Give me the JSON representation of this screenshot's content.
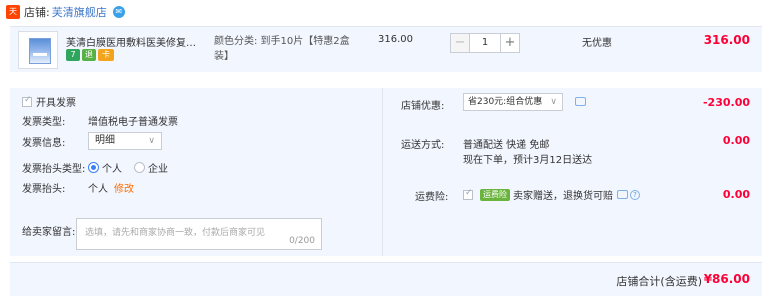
{
  "store": {
    "logo_text": "天猫",
    "prefix": "店铺:",
    "name": "芙清旗舰店"
  },
  "product": {
    "title": "芙清白膜医用敷料医美修复痘痘肌",
    "sku": "颜色分类: 到手10片【特惠2盒装】",
    "unit_price": "316.00",
    "quantity": "1",
    "discount": "无优惠",
    "total": "316.00",
    "service_icons": [
      "7",
      "退",
      "卡"
    ]
  },
  "invoice": {
    "enable_label": "开具发票",
    "type_label": "发票类型:",
    "type_value": "增值税电子普通发票",
    "info_label": "发票信息:",
    "info_value": "明细",
    "title_type_label": "发票抬头类型:",
    "title_type_options": [
      "个人",
      "企业"
    ],
    "title_label": "发票抬头:",
    "title_value": "个人",
    "edit_link": "修改"
  },
  "message": {
    "label": "给卖家留言:",
    "placeholder": "选填，请先和商家协商一致，付款后商家可见",
    "count": "0/200"
  },
  "summary": {
    "coupon_label": "店铺优惠:",
    "coupon_value": "省230元:组合优惠",
    "coupon_amount": "-230.00",
    "shipping_label": "运送方式:",
    "shipping_line1": "普通配送 快递 免邮",
    "shipping_line2": "现在下单，预计3月12日送达",
    "shipping_amount": "0.00",
    "insurance_label": "运费险:",
    "insurance_tag": "运费险",
    "insurance_text": "卖家赠送，退换货可赔",
    "insurance_amount": "0.00"
  },
  "footer": {
    "label": "店铺合计(含运费)",
    "total": "¥86.00"
  }
}
